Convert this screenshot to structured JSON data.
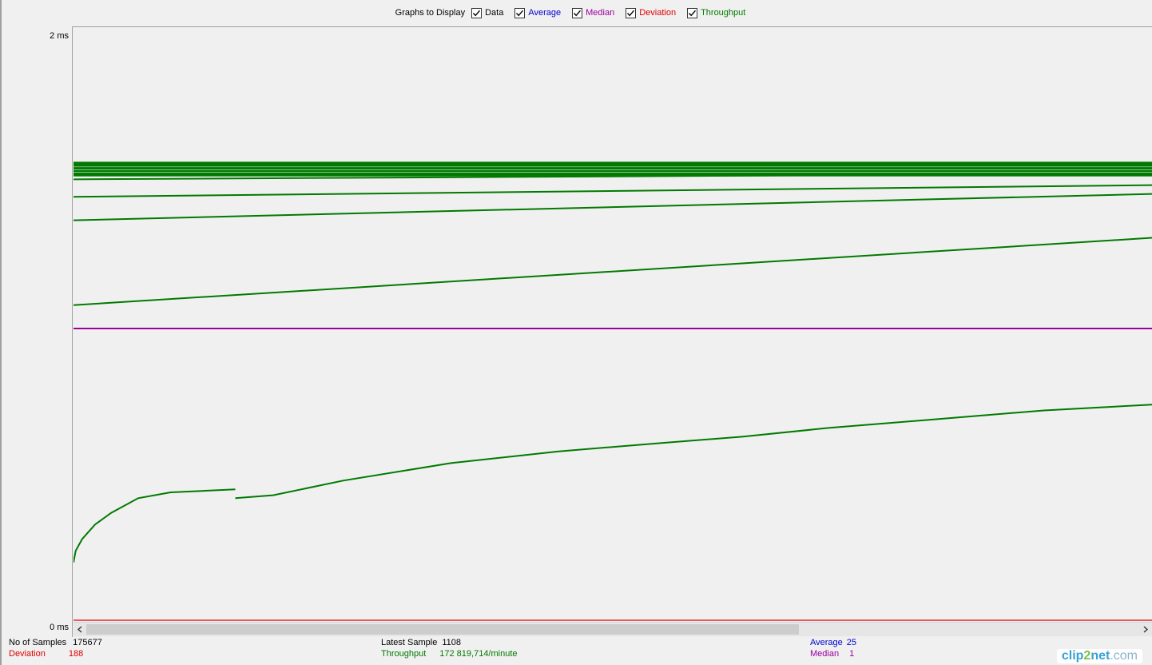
{
  "toolbar": {
    "title": "Graphs to Display",
    "checkboxes": [
      {
        "label": "Data",
        "checked": true,
        "color": "#000000"
      },
      {
        "label": "Average",
        "checked": true,
        "color": "#0000cc"
      },
      {
        "label": "Median",
        "checked": true,
        "color": "#9b009b"
      },
      {
        "label": "Deviation",
        "checked": true,
        "color": "#e00000"
      },
      {
        "label": "Throughput",
        "checked": true,
        "color": "#007a00"
      }
    ]
  },
  "chart_data": {
    "type": "line",
    "ytick_top": "2  ms",
    "ytick_bottom": "0  ms",
    "ylim": [
      0,
      2
    ],
    "colors": {
      "data": "#000000",
      "average": "#0000cc",
      "median": "#9b009b",
      "deviation": "#e00000",
      "throughput": "#007a00"
    },
    "median_value_ms": 1,
    "deviation_level_ms": 0.0,
    "throughput_band": {
      "from_ms": 1.57,
      "to_ms": 1.52
    },
    "throughput_lines": [
      {
        "y_start": 1.51,
        "y_end": 1.53
      },
      {
        "y_start": 1.45,
        "y_end": 1.49
      },
      {
        "y_start": 1.37,
        "y_end": 1.46
      },
      {
        "y_start": 1.08,
        "y_end": 1.31
      }
    ],
    "throughput_curve": [
      [
        0.0,
        0.2
      ],
      [
        0.002,
        0.24
      ],
      [
        0.008,
        0.28
      ],
      [
        0.02,
        0.33
      ],
      [
        0.035,
        0.37
      ],
      [
        0.06,
        0.42
      ],
      [
        0.09,
        0.44
      ],
      [
        0.15,
        0.45
      ],
      [
        0.149,
        0.45
      ],
      [
        0.15,
        0.42
      ],
      [
        0.185,
        0.43
      ],
      [
        0.25,
        0.48
      ],
      [
        0.35,
        0.54
      ],
      [
        0.45,
        0.58
      ],
      [
        0.55,
        0.61
      ],
      [
        0.62,
        0.63
      ],
      [
        0.7,
        0.66
      ],
      [
        0.8,
        0.69
      ],
      [
        0.9,
        0.72
      ],
      [
        1.0,
        0.74
      ]
    ]
  },
  "status": {
    "samples_label": "No of Samples",
    "samples_value": "175677",
    "deviation_label": "Deviation",
    "deviation_value": "188",
    "latest_label": "Latest Sample",
    "latest_value": "1108",
    "throughput_label": "Throughput",
    "throughput_value": "172 819,714/minute",
    "average_label": "Average",
    "average_value": "25",
    "median_label": "Median",
    "median_value": "1"
  },
  "watermark": {
    "part1": "clip",
    "part2": "2",
    "part3": "net",
    "part4": ".com"
  }
}
